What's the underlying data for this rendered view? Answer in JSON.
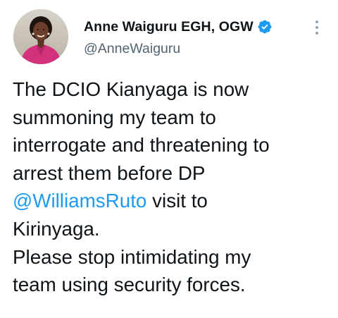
{
  "tweet": {
    "author": {
      "display_name": "Anne Waiguru EGH, OGW",
      "handle": "@AnneWaiguru",
      "verified_icon": "verified-badge-icon",
      "avatar": "profile-photo"
    },
    "more_icon": "more-vertical-icon",
    "text": {
      "line1": "The DCIO Kianyaga is now",
      "line2": "summoning my team to",
      "line3": "interrogate and threatening to",
      "line4": "arrest them before DP",
      "mention": "@WilliamsRuto",
      "line5_rest": " visit to",
      "line6": "Kirinyaga.",
      "line7": "Please stop intimidating my",
      "line8": "team using security forces."
    }
  },
  "colors": {
    "text": "#0f1419",
    "secondary_text": "#536471",
    "link": "#1d9bf0",
    "verified": "#1d9bf0",
    "background": "#ffffff"
  }
}
